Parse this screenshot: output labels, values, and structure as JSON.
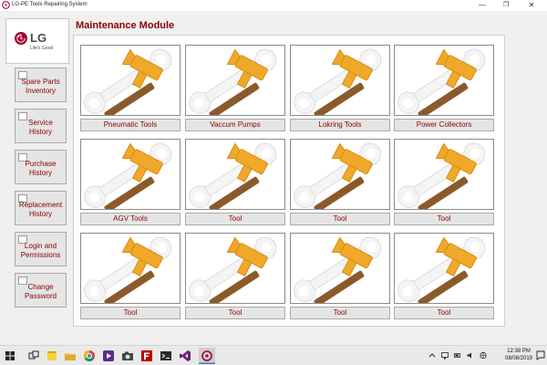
{
  "window": {
    "title": "LG-PE Tools Repairing System",
    "minimize_glyph": "—",
    "maximize_glyph": "❐",
    "close_glyph": "✕"
  },
  "brand": {
    "logo_text": "LG",
    "slogan": "Life's Good",
    "color": "#a50034"
  },
  "sidebar": {
    "items": [
      {
        "label": "Spare Parts Inventory"
      },
      {
        "label": "Service History"
      },
      {
        "label": "Purchase History"
      },
      {
        "label": "Replacement History"
      },
      {
        "label": "Login and Permissions"
      },
      {
        "label": "Change Password"
      }
    ]
  },
  "main": {
    "title": "Maintenance Module",
    "tiles": [
      {
        "label": "Pneumatic Tools"
      },
      {
        "label": "Vaccum Pumps"
      },
      {
        "label": "Lokring Tools"
      },
      {
        "label": "Power Collectors"
      },
      {
        "label": "AGV Tools"
      },
      {
        "label": "Tool"
      },
      {
        "label": "Tool"
      },
      {
        "label": "Tool"
      },
      {
        "label": "Tool"
      },
      {
        "label": "Tool"
      },
      {
        "label": "Tool"
      },
      {
        "label": "Tool"
      }
    ]
  },
  "colors": {
    "accent_text": "#8b0000",
    "hammer_head": "#f0a82a",
    "hammer_handle": "#8b5a2b",
    "wrench": "#f4f4f4"
  },
  "taskbar": {
    "items": [
      {
        "name": "windows-start-icon"
      },
      {
        "name": "task-view-icon"
      },
      {
        "name": "sticky-notes-icon"
      },
      {
        "name": "file-explorer-icon"
      },
      {
        "name": "chrome-icon"
      },
      {
        "name": "media-player-icon"
      },
      {
        "name": "camera-icon"
      },
      {
        "name": "filezilla-icon"
      },
      {
        "name": "terminal-icon"
      },
      {
        "name": "visual-studio-icon"
      },
      {
        "name": "app-running-icon"
      }
    ],
    "tray": {
      "time": "12:38 PM",
      "date": "08/08/2019",
      "icons": [
        "chevron-up-icon",
        "network-icon",
        "battery-icon",
        "volume-icon",
        "language-icon"
      ]
    }
  }
}
